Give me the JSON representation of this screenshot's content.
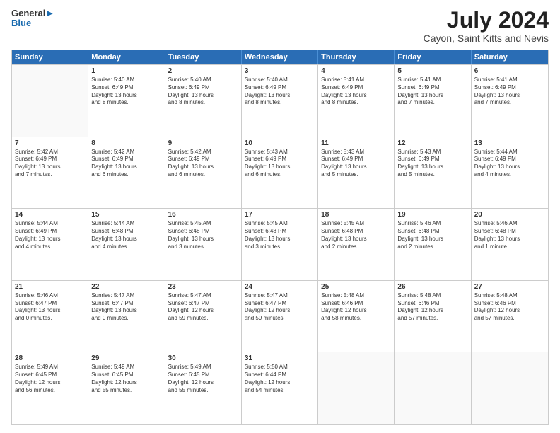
{
  "header": {
    "logo_line1": "General",
    "logo_line2": "Blue",
    "month": "July 2024",
    "location": "Cayon, Saint Kitts and Nevis"
  },
  "days_of_week": [
    "Sunday",
    "Monday",
    "Tuesday",
    "Wednesday",
    "Thursday",
    "Friday",
    "Saturday"
  ],
  "weeks": [
    [
      {
        "day": "",
        "info": ""
      },
      {
        "day": "1",
        "info": "Sunrise: 5:40 AM\nSunset: 6:49 PM\nDaylight: 13 hours\nand 8 minutes."
      },
      {
        "day": "2",
        "info": "Sunrise: 5:40 AM\nSunset: 6:49 PM\nDaylight: 13 hours\nand 8 minutes."
      },
      {
        "day": "3",
        "info": "Sunrise: 5:40 AM\nSunset: 6:49 PM\nDaylight: 13 hours\nand 8 minutes."
      },
      {
        "day": "4",
        "info": "Sunrise: 5:41 AM\nSunset: 6:49 PM\nDaylight: 13 hours\nand 8 minutes."
      },
      {
        "day": "5",
        "info": "Sunrise: 5:41 AM\nSunset: 6:49 PM\nDaylight: 13 hours\nand 7 minutes."
      },
      {
        "day": "6",
        "info": "Sunrise: 5:41 AM\nSunset: 6:49 PM\nDaylight: 13 hours\nand 7 minutes."
      }
    ],
    [
      {
        "day": "7",
        "info": "Sunrise: 5:42 AM\nSunset: 6:49 PM\nDaylight: 13 hours\nand 7 minutes."
      },
      {
        "day": "8",
        "info": "Sunrise: 5:42 AM\nSunset: 6:49 PM\nDaylight: 13 hours\nand 6 minutes."
      },
      {
        "day": "9",
        "info": "Sunrise: 5:42 AM\nSunset: 6:49 PM\nDaylight: 13 hours\nand 6 minutes."
      },
      {
        "day": "10",
        "info": "Sunrise: 5:43 AM\nSunset: 6:49 PM\nDaylight: 13 hours\nand 6 minutes."
      },
      {
        "day": "11",
        "info": "Sunrise: 5:43 AM\nSunset: 6:49 PM\nDaylight: 13 hours\nand 5 minutes."
      },
      {
        "day": "12",
        "info": "Sunrise: 5:43 AM\nSunset: 6:49 PM\nDaylight: 13 hours\nand 5 minutes."
      },
      {
        "day": "13",
        "info": "Sunrise: 5:44 AM\nSunset: 6:49 PM\nDaylight: 13 hours\nand 4 minutes."
      }
    ],
    [
      {
        "day": "14",
        "info": "Sunrise: 5:44 AM\nSunset: 6:49 PM\nDaylight: 13 hours\nand 4 minutes."
      },
      {
        "day": "15",
        "info": "Sunrise: 5:44 AM\nSunset: 6:48 PM\nDaylight: 13 hours\nand 4 minutes."
      },
      {
        "day": "16",
        "info": "Sunrise: 5:45 AM\nSunset: 6:48 PM\nDaylight: 13 hours\nand 3 minutes."
      },
      {
        "day": "17",
        "info": "Sunrise: 5:45 AM\nSunset: 6:48 PM\nDaylight: 13 hours\nand 3 minutes."
      },
      {
        "day": "18",
        "info": "Sunrise: 5:45 AM\nSunset: 6:48 PM\nDaylight: 13 hours\nand 2 minutes."
      },
      {
        "day": "19",
        "info": "Sunrise: 5:46 AM\nSunset: 6:48 PM\nDaylight: 13 hours\nand 2 minutes."
      },
      {
        "day": "20",
        "info": "Sunrise: 5:46 AM\nSunset: 6:48 PM\nDaylight: 13 hours\nand 1 minute."
      }
    ],
    [
      {
        "day": "21",
        "info": "Sunrise: 5:46 AM\nSunset: 6:47 PM\nDaylight: 13 hours\nand 0 minutes."
      },
      {
        "day": "22",
        "info": "Sunrise: 5:47 AM\nSunset: 6:47 PM\nDaylight: 13 hours\nand 0 minutes."
      },
      {
        "day": "23",
        "info": "Sunrise: 5:47 AM\nSunset: 6:47 PM\nDaylight: 12 hours\nand 59 minutes."
      },
      {
        "day": "24",
        "info": "Sunrise: 5:47 AM\nSunset: 6:47 PM\nDaylight: 12 hours\nand 59 minutes."
      },
      {
        "day": "25",
        "info": "Sunrise: 5:48 AM\nSunset: 6:46 PM\nDaylight: 12 hours\nand 58 minutes."
      },
      {
        "day": "26",
        "info": "Sunrise: 5:48 AM\nSunset: 6:46 PM\nDaylight: 12 hours\nand 57 minutes."
      },
      {
        "day": "27",
        "info": "Sunrise: 5:48 AM\nSunset: 6:46 PM\nDaylight: 12 hours\nand 57 minutes."
      }
    ],
    [
      {
        "day": "28",
        "info": "Sunrise: 5:49 AM\nSunset: 6:45 PM\nDaylight: 12 hours\nand 56 minutes."
      },
      {
        "day": "29",
        "info": "Sunrise: 5:49 AM\nSunset: 6:45 PM\nDaylight: 12 hours\nand 55 minutes."
      },
      {
        "day": "30",
        "info": "Sunrise: 5:49 AM\nSunset: 6:45 PM\nDaylight: 12 hours\nand 55 minutes."
      },
      {
        "day": "31",
        "info": "Sunrise: 5:50 AM\nSunset: 6:44 PM\nDaylight: 12 hours\nand 54 minutes."
      },
      {
        "day": "",
        "info": ""
      },
      {
        "day": "",
        "info": ""
      },
      {
        "day": "",
        "info": ""
      }
    ]
  ]
}
